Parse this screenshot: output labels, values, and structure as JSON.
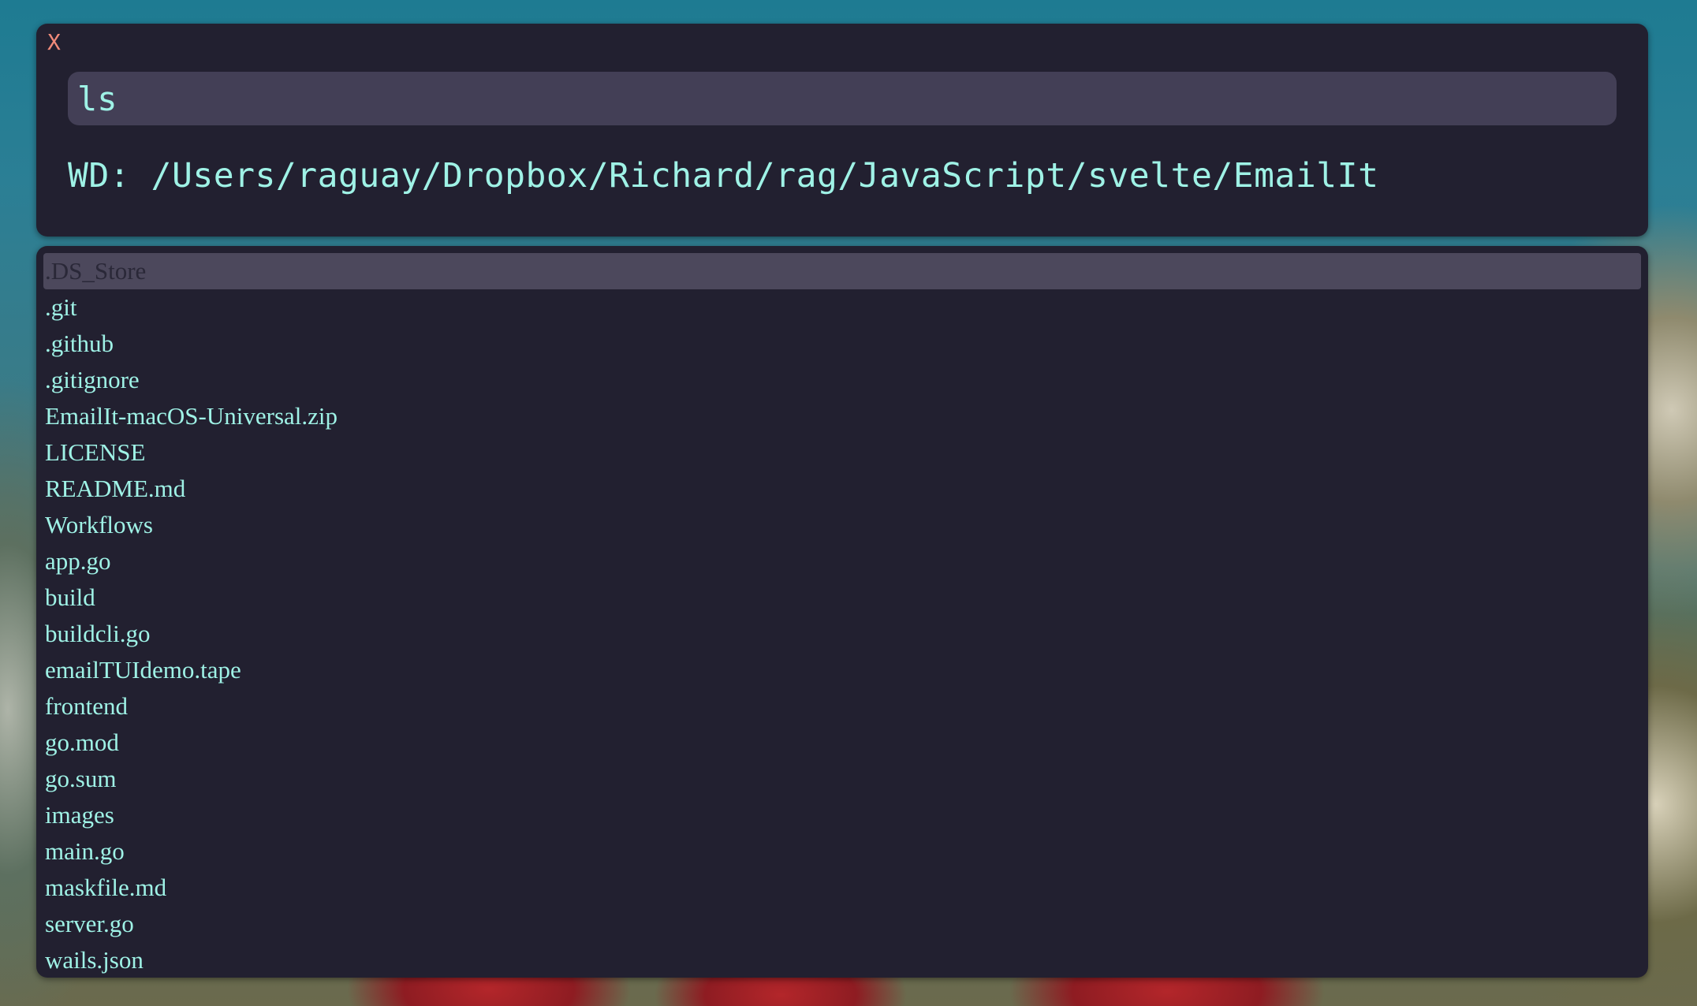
{
  "window": {
    "close_label": "X"
  },
  "command": {
    "value": "ls"
  },
  "working_directory": {
    "text": "WD: /Users/raguay/Dropbox/Richard/rag/JavaScript/svelte/EmailIt"
  },
  "files": {
    "selected_index": 0,
    "items": [
      ".DS_Store",
      ".git",
      ".github",
      ".gitignore",
      "EmailIt-macOS-Universal.zip",
      "LICENSE",
      "README.md",
      "Workflows",
      "app.go",
      "build",
      "buildcli.go",
      "emailTUIdemo.tape",
      "frontend",
      "go.mod",
      "go.sum",
      "images",
      "main.go",
      "maskfile.md",
      "server.go",
      "wails.json"
    ]
  },
  "colors": {
    "panel_bg": "#222030",
    "input_bg": "#433f56",
    "text_accent": "#9ff2e6",
    "close_color": "#f08a7a",
    "selected_bg": "#4c485c"
  }
}
